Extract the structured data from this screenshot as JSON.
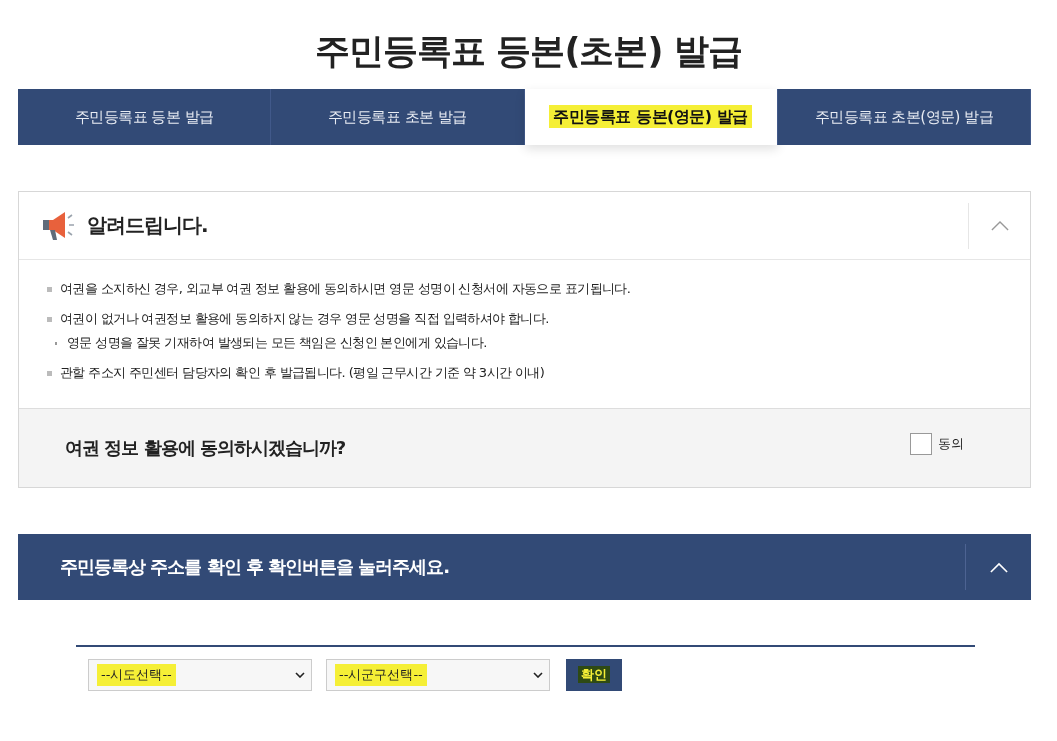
{
  "title": "주민등록표 등본(초본) 발급",
  "tabs": [
    {
      "label": "주민등록표 등본 발급",
      "selected": false,
      "highlighted": false
    },
    {
      "label": "주민등록표 초본 발급",
      "selected": false,
      "highlighted": false
    },
    {
      "label": "주민등록표 등본(영문) 발급",
      "selected": true,
      "highlighted": true
    },
    {
      "label": "주민등록표 초본(영문) 발급",
      "selected": false,
      "highlighted": false
    }
  ],
  "notice": {
    "title": "알려드립니다.",
    "expanded": true,
    "items": [
      {
        "kind": "main",
        "text": "여권을 소지하신 경우, 외교부 여권 정보 활용에 동의하시면 영문 성명이 신청서에 자동으로 표기됩니다."
      },
      {
        "kind": "main",
        "text": "여권이 없거나 여권정보 활용에 동의하지 않는 경우 영문 성명을 직접 입력하셔야 합니다."
      },
      {
        "kind": "sub",
        "text": "영문 성명을 잘못 기재하여 발생되는 모든 책임은 신청인 본인에게 있습니다."
      },
      {
        "kind": "main",
        "text": "관할 주소지 주민센터 담당자의 확인 후 발급됩니다. (평일 근무시간 기준 약 3시간 이내)"
      }
    ],
    "consent": {
      "question": "여권 정보 활용에 동의하시겠습니까?",
      "label": "동의",
      "checked": false
    }
  },
  "address": {
    "title": "주민등록상 주소를 확인 후 확인버튼을 눌러주세요.",
    "expanded": true,
    "selects": [
      {
        "value": "--시도선택--",
        "highlighted": true
      },
      {
        "value": "--시군구선택--",
        "highlighted": true
      }
    ],
    "button": {
      "label": "확인",
      "highlighted": true
    }
  }
}
